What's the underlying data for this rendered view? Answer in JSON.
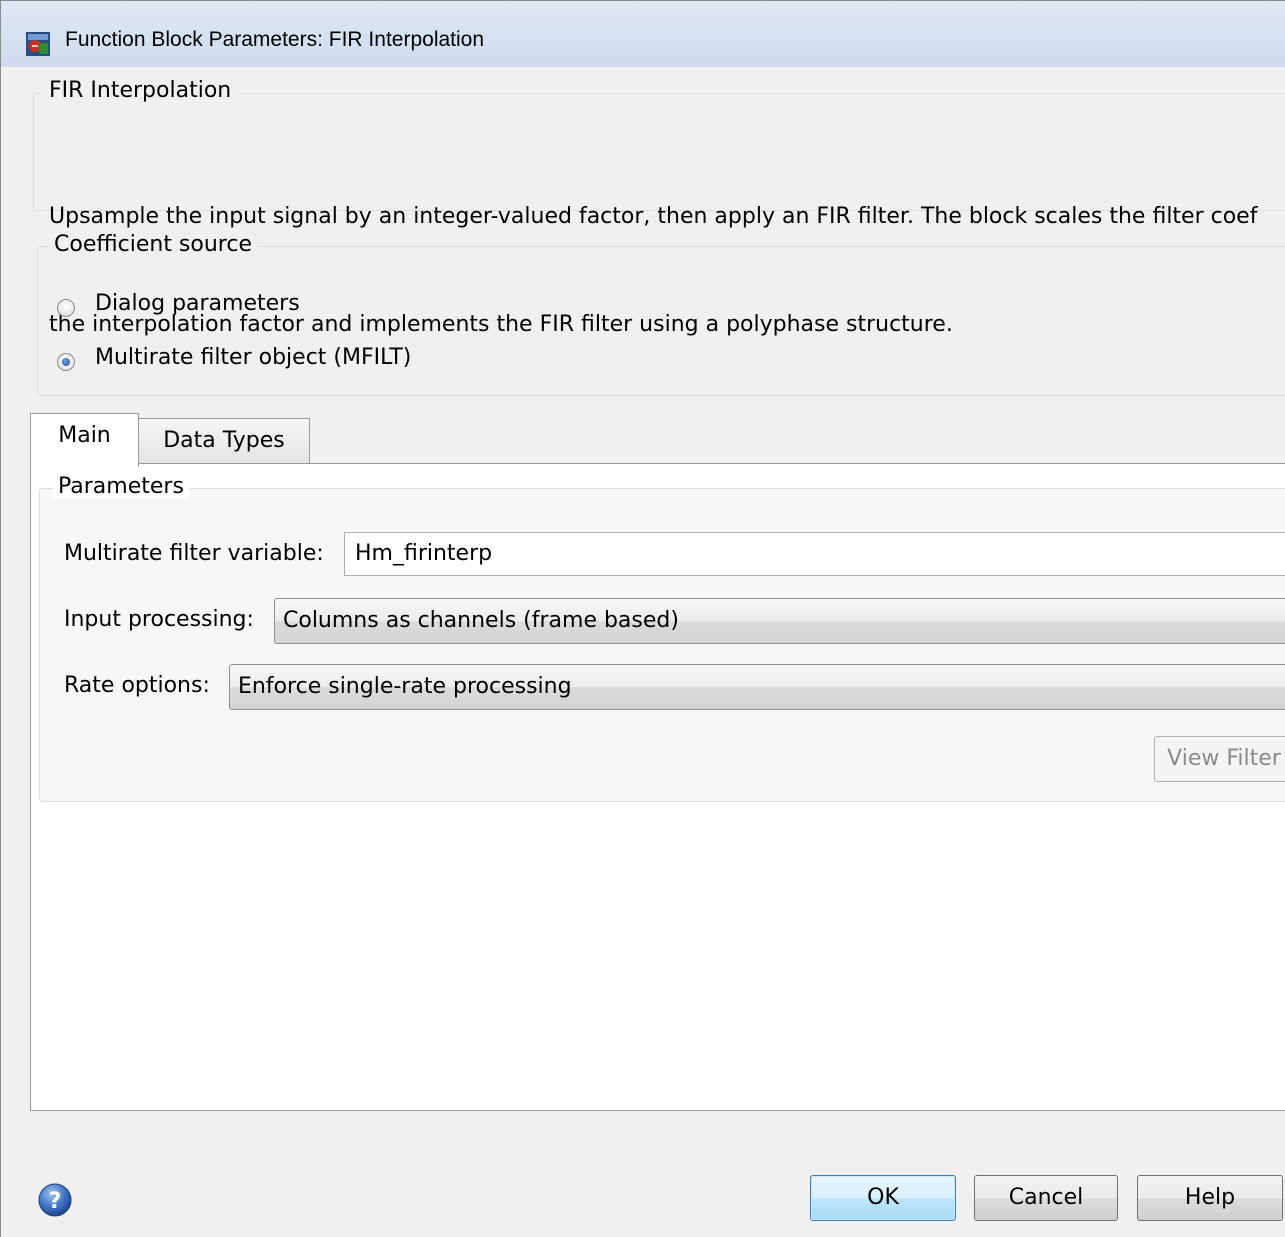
{
  "window": {
    "title": "Function Block Parameters: FIR Interpolation"
  },
  "block": {
    "name": "FIR Interpolation",
    "description_line1": "Upsample the input signal by an integer-valued factor, then apply an FIR filter. The block scales the filter coef",
    "description_line2": "the interpolation factor and implements the FIR filter using a polyphase structure."
  },
  "coefficient_source": {
    "legend": "Coefficient source",
    "options": [
      {
        "label": "Dialog parameters",
        "checked": false
      },
      {
        "label": "Multirate filter object (MFILT)",
        "checked": true
      }
    ]
  },
  "tabs": [
    {
      "label": "Main",
      "active": true
    },
    {
      "label": "Data Types",
      "active": false
    }
  ],
  "parameters": {
    "legend": "Parameters",
    "multirate_filter_variable": {
      "label": "Multirate filter variable:",
      "value": "Hm_firinterp"
    },
    "input_processing": {
      "label": "Input processing:",
      "selected": "Columns as channels (frame based)"
    },
    "rate_options": {
      "label": "Rate options:",
      "selected": "Enforce single-rate processing"
    },
    "view_filter_button": "View Filter"
  },
  "footer": {
    "help_icon": "question-icon",
    "ok": "OK",
    "cancel": "Cancel",
    "help": "Help"
  }
}
